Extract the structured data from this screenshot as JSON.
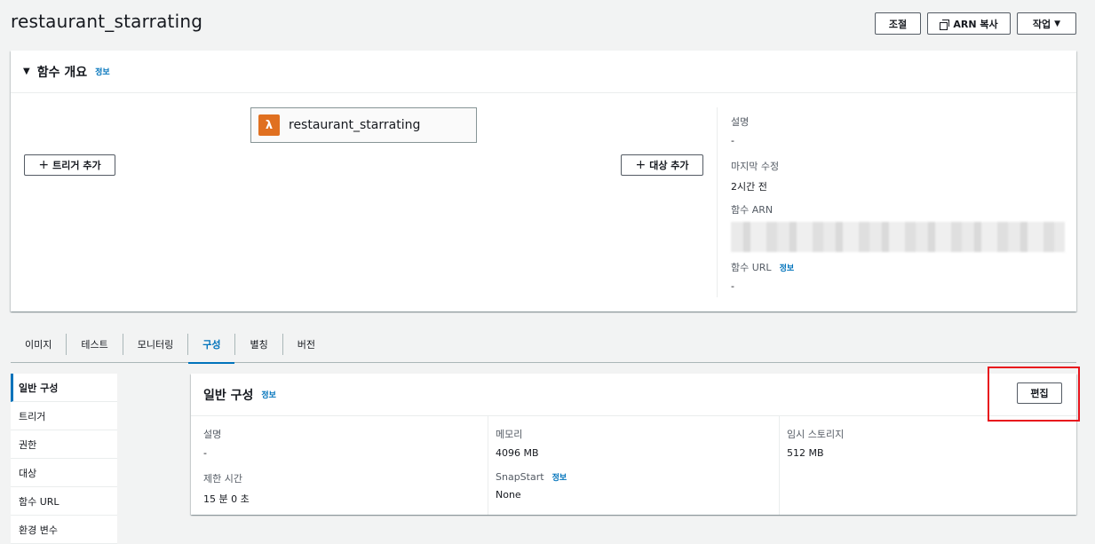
{
  "page": {
    "title": "restaurant_starrating"
  },
  "header_buttons": {
    "throttle": "조절",
    "copy_arn": "ARN 복사",
    "actions": "작업"
  },
  "overview": {
    "title": "함수 개요",
    "info": "정보",
    "function_name": "restaurant_starrating",
    "add_trigger": "트리거 추가",
    "add_destination": "대상 추가",
    "description_label": "설명",
    "description_value": "-",
    "last_modified_label": "마지막 수정",
    "last_modified_value": "2시간 전",
    "arn_label": "함수 ARN",
    "url_label": "함수 URL",
    "url_info": "정보",
    "url_value": "-"
  },
  "tabs": [
    {
      "label": "이미지"
    },
    {
      "label": "테스트"
    },
    {
      "label": "모니터링"
    },
    {
      "label": "구성",
      "active": true
    },
    {
      "label": "별칭"
    },
    {
      "label": "버전"
    }
  ],
  "sidenav": [
    {
      "label": "일반 구성",
      "active": true
    },
    {
      "label": "트리거"
    },
    {
      "label": "권한"
    },
    {
      "label": "대상"
    },
    {
      "label": "함수 URL"
    },
    {
      "label": "환경 변수"
    }
  ],
  "general_config": {
    "title": "일반 구성",
    "info": "정보",
    "edit": "편집",
    "description_label": "설명",
    "description_value": "-",
    "timeout_label": "제한 시간",
    "timeout_value": "15 분 0 초",
    "memory_label": "메모리",
    "memory_value": "4096 MB",
    "snapstart_label": "SnapStart",
    "snapstart_info": "정보",
    "snapstart_value": "None",
    "ephemeral_label": "임시 스토리지",
    "ephemeral_value": "512 MB"
  },
  "colors": {
    "accent": "#0073bb",
    "lambda": "#e07020",
    "highlight": "#e8141c"
  }
}
